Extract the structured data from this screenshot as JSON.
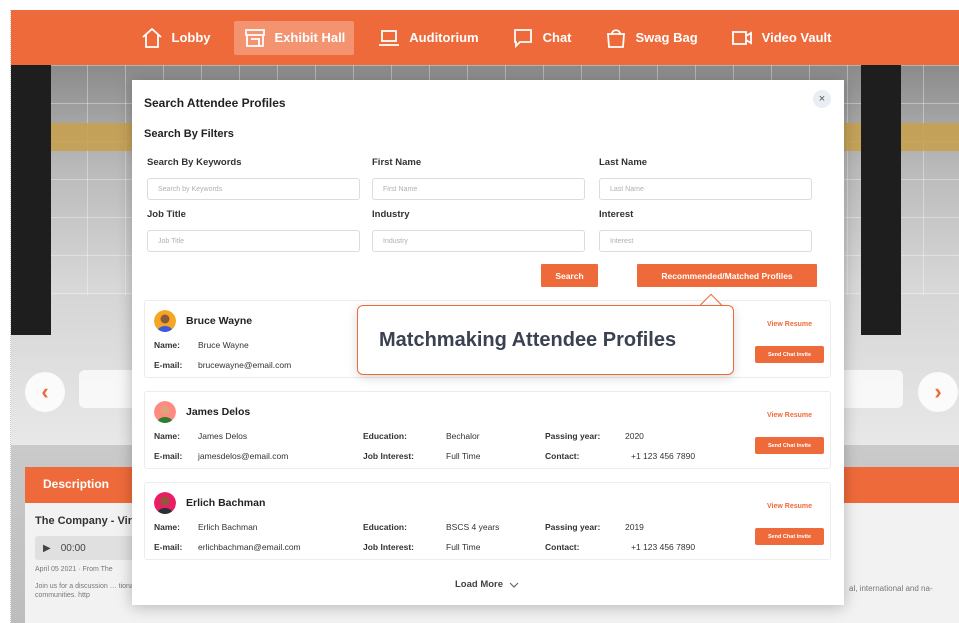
{
  "nav": {
    "items": [
      {
        "label": "Lobby",
        "icon": "home-icon",
        "active": false
      },
      {
        "label": "Exhibit Hall",
        "icon": "storefront-icon",
        "active": true
      },
      {
        "label": "Auditorium",
        "icon": "laptop-icon",
        "active": false
      },
      {
        "label": "Chat",
        "icon": "chat-bubble-icon",
        "active": false
      },
      {
        "label": "Swag Bag",
        "icon": "bag-icon",
        "active": false
      },
      {
        "label": "Video Vault",
        "icon": "video-camera-icon",
        "active": false
      }
    ]
  },
  "background": {
    "description_label": "Description",
    "company_text": "The Company - Virt",
    "player_time": "00:00",
    "date_text": "April 05 2021 · From The",
    "join_text": "Join us for a discussion … tional communities. http",
    "intl_text": "al, international and na-"
  },
  "modal": {
    "title": "Search Attendee Profiles",
    "close_label": "×",
    "filters_title": "Search By Filters",
    "fields": [
      {
        "label": "Search By Keywords",
        "placeholder": "Search by Keywords"
      },
      {
        "label": "First Name",
        "placeholder": "First Name"
      },
      {
        "label": "Last Name",
        "placeholder": "Last Name"
      },
      {
        "label": "Job Title",
        "placeholder": "Job Title"
      },
      {
        "label": "Industry",
        "placeholder": "Industry"
      },
      {
        "label": "Interest",
        "placeholder": "Interest"
      }
    ],
    "search_button": "Search",
    "matched_button": "Recommended/Matched Profiles",
    "load_more": "Load More",
    "labels": {
      "name": "Name:",
      "email": "E-mail:",
      "education": "Education:",
      "job_interest": "Job Interest:",
      "passing_year": "Passing year:",
      "contact": "Contact:",
      "view_resume": "View Resume",
      "send_chat": "Send Chat Invite"
    },
    "profiles": [
      {
        "name": "Bruce Wayne",
        "email": "brucewayne@email.com",
        "education": "",
        "job_interest": "",
        "passing_year": "",
        "contact": ""
      },
      {
        "name": "James Delos",
        "email": "jamesdelos@email.com",
        "education": "Bechalor",
        "job_interest": "Full Time",
        "passing_year": "2020",
        "contact": "+1 123 456 7890"
      },
      {
        "name": "Erlich Bachman",
        "email": "erlichbachman@email.com",
        "education": "BSCS 4 years",
        "job_interest": "Full Time",
        "passing_year": "2019",
        "contact": "+1 123 456 7890"
      }
    ]
  },
  "callout": {
    "text": "Matchmaking Attendee Profiles"
  },
  "colors": {
    "accent": "#ef6a3a",
    "text_dark": "#222222",
    "callout_text": "#3a4150"
  }
}
